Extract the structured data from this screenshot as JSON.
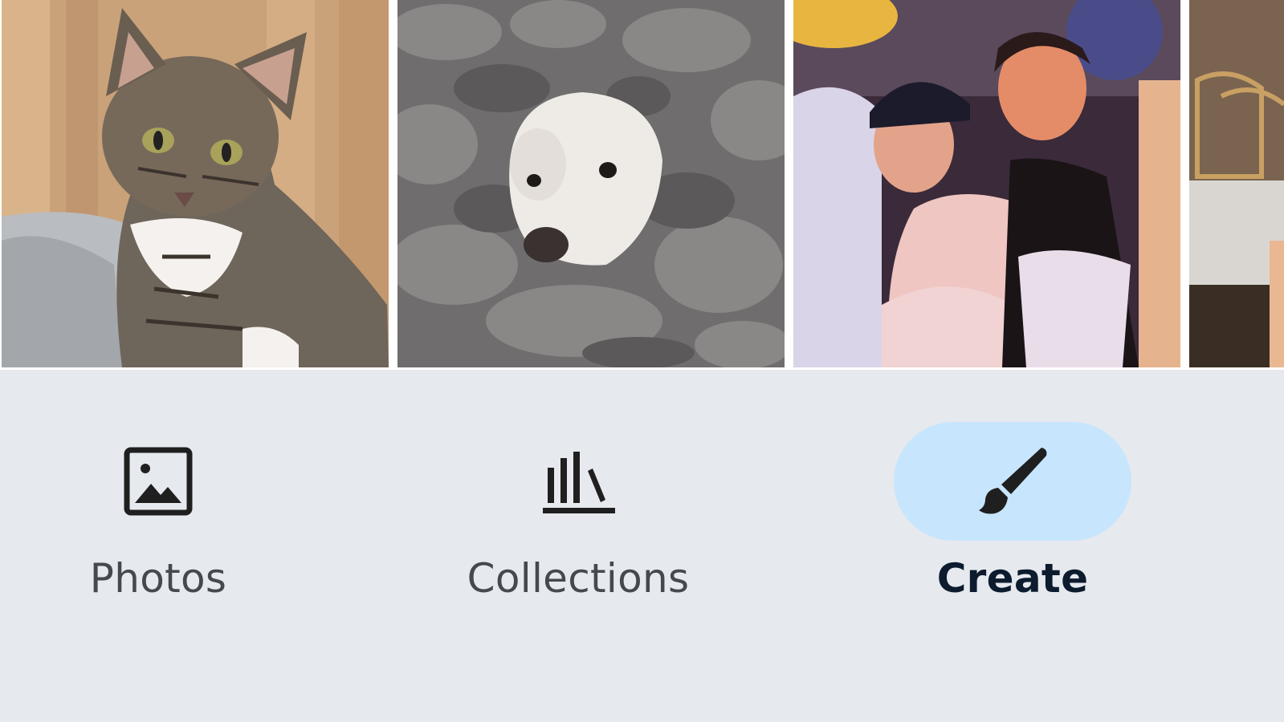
{
  "photo_strip": {
    "items": [
      {
        "subject": "tabby cat"
      },
      {
        "subject": "white dog in grey blanket"
      },
      {
        "subject": "two women at a party"
      },
      {
        "subject": "cafe chairs"
      }
    ]
  },
  "nav": {
    "items": [
      {
        "label": "Photos",
        "icon": "photo-icon",
        "selected": false
      },
      {
        "label": "Collections",
        "icon": "collections-icon",
        "selected": false
      },
      {
        "label": "Create",
        "icon": "brush-icon",
        "selected": true
      }
    ],
    "colors": {
      "background": "#e6e9ee",
      "selected_pill": "#c7e6fd",
      "label": "#45484d",
      "selected_label": "#0d1b2e",
      "icon": "#1f1f1f"
    }
  }
}
